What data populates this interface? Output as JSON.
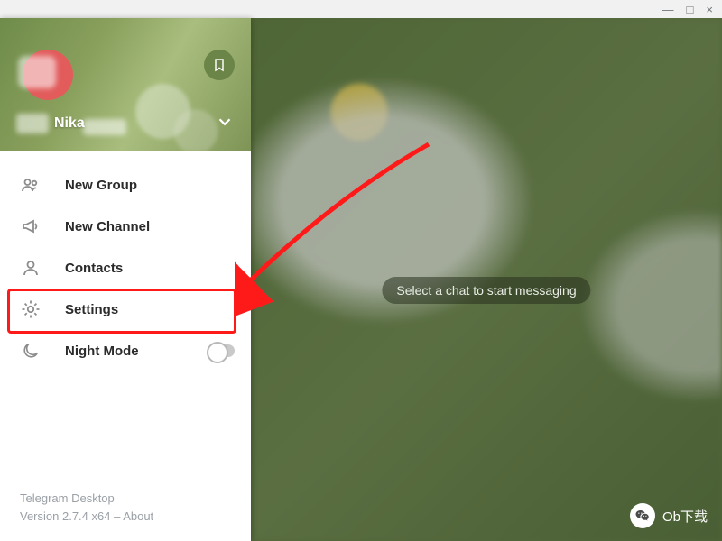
{
  "window": {
    "min": "—",
    "max": "□",
    "close": "×"
  },
  "user": {
    "name": "Nika"
  },
  "menu": {
    "new_group": "New Group",
    "new_channel": "New Channel",
    "contacts": "Contacts",
    "settings": "Settings",
    "night_mode": "Night Mode"
  },
  "footer": {
    "app": "Telegram Desktop",
    "version_line": "Version 2.7.4 x64 – About"
  },
  "main": {
    "empty": "Select a chat to start messaging"
  },
  "watermark": {
    "text": "Ob下载"
  }
}
